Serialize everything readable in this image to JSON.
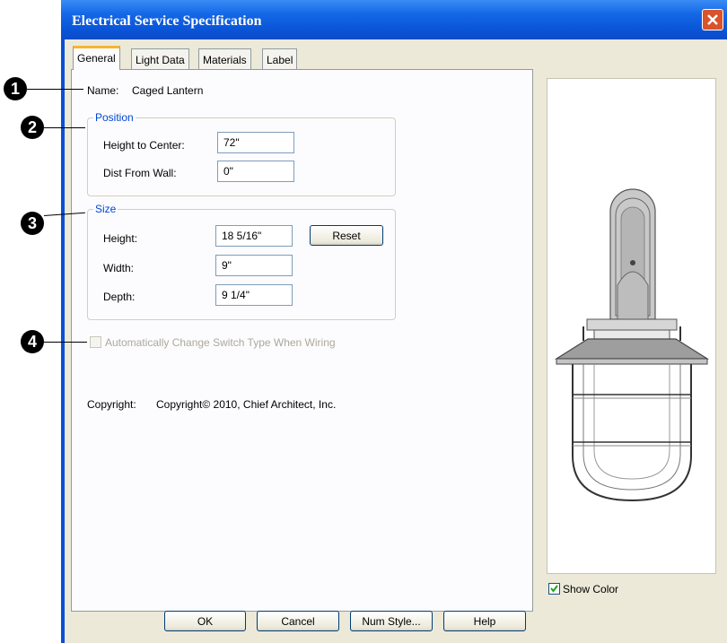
{
  "window": {
    "title": "Electrical Service Specification",
    "close_icon": "close-icon"
  },
  "tabs": [
    {
      "label": "General"
    },
    {
      "label": "Light Data"
    },
    {
      "label": "Materials"
    },
    {
      "label": "Label"
    }
  ],
  "general": {
    "name_label": "Name:",
    "name_value": "Caged Lantern",
    "position": {
      "legend": "Position",
      "height_label": "Height to Center:",
      "height_value": "72\"",
      "dist_label": "Dist From Wall:",
      "dist_value": "0\""
    },
    "size": {
      "legend": "Size",
      "height_label": "Height:",
      "height_value": "18 5/16\"",
      "reset_label": "Reset",
      "width_label": "Width:",
      "width_value": "9\"",
      "depth_label": "Depth:",
      "depth_value": "9 1/4\""
    },
    "auto_switch_label": "Automatically Change Switch Type When Wiring",
    "auto_switch_checked": false,
    "copyright_label": "Copyright:",
    "copyright_value": "Copyright© 2010, Chief Architect, Inc."
  },
  "preview": {
    "show_color_label": "Show Color",
    "show_color_checked": true
  },
  "buttons": {
    "ok": "OK",
    "cancel": "Cancel",
    "num_style": "Num Style...",
    "help": "Help"
  },
  "callouts": [
    "1",
    "2",
    "3",
    "4"
  ],
  "colors": {
    "title_bar": "#0a54d8",
    "dialog_bg": "#ece9d8",
    "tab_accent": "#f7b530",
    "group_legend": "#0046d5"
  }
}
